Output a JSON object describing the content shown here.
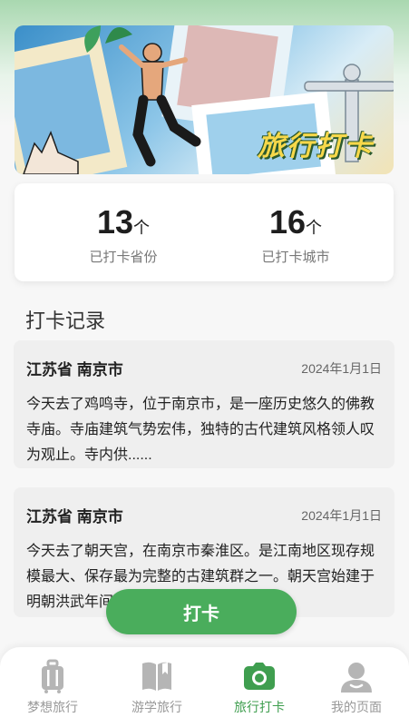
{
  "banner": {
    "title": "旅行打卡"
  },
  "stats": [
    {
      "value": "13",
      "unit": "个",
      "label": "已打卡省份"
    },
    {
      "value": "16",
      "unit": "个",
      "label": "已打卡城市"
    }
  ],
  "records_section": {
    "title": "打卡记录"
  },
  "records": [
    {
      "location": "江苏省 南京市",
      "date": "2024年1月1日",
      "text": "今天去了鸡鸣寺，位于南京市，是一座历史悠久的佛教寺庙。寺庙建筑气势宏伟，独特的古代建筑风格领人叹为观止。寺内供......"
    },
    {
      "location": "江苏省 南京市",
      "date": "2024年1月1日",
      "text": "今天去了朝天宫，在南京市秦淮区。是江南地区现存规模最大、保存最为完整的古建筑群之一。朝天宫始建于明朝洪武年间"
    }
  ],
  "checkin_button": {
    "label": "打卡"
  },
  "tabs": [
    {
      "label": "梦想旅行",
      "icon": "luggage-icon"
    },
    {
      "label": "游学旅行",
      "icon": "book-icon"
    },
    {
      "label": "旅行打卡",
      "icon": "camera-icon",
      "active": true
    },
    {
      "label": "我的页面",
      "icon": "user-icon"
    }
  ],
  "colors": {
    "accent": "#4aad5c",
    "active_tab": "#3f9e4f",
    "inactive_tab": "#b5b5b5"
  }
}
